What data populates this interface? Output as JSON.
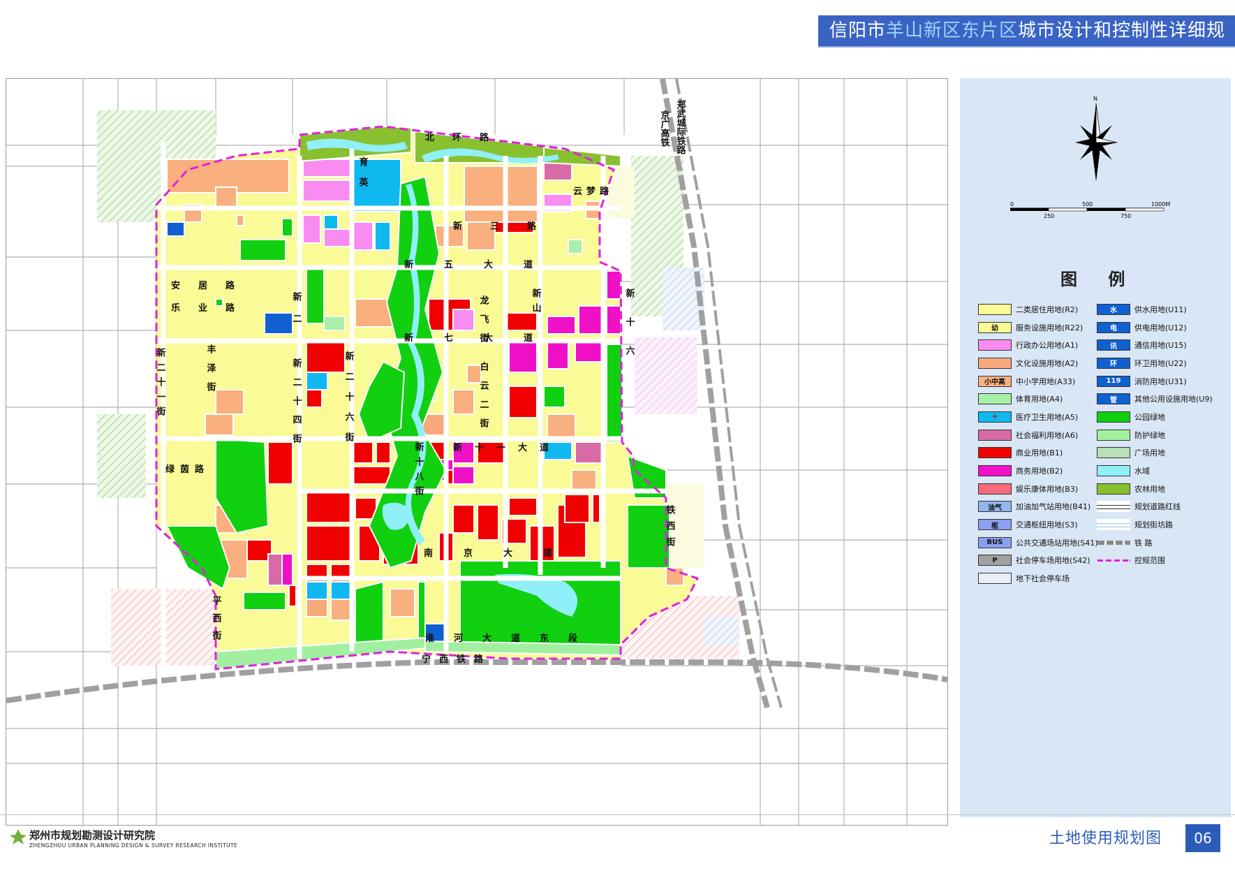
{
  "header": {
    "title_part1": "信阳市",
    "title_highlight": "羊山新区东片区",
    "title_part2": "城市设计和控制性详细规划"
  },
  "map": {
    "roads": {
      "north_ring": "北环路",
      "yuying": "育英",
      "xin_san": "新三路",
      "xin_wu": "新五大道",
      "xin_qi": "新七大道",
      "xin_shiyi": "新十一大道",
      "nanjing": "南京大道",
      "huaihe": "淮河大道东段",
      "ningxi_rail": "宁西铁路",
      "jingguang_rail": "京广高铁",
      "zhengwu_rail": "郑武城际铁路",
      "xin_er": "新二",
      "xin_ershiyi": "新二十一街",
      "xin_shiba": "新十八街",
      "xin_shiliu": "新十六",
      "xin_ershisi": "新二十四街",
      "xin_ershiliu": "新二十六街",
      "longfei": "龙飞街",
      "baiyun": "白云二街",
      "xinshan": "新山",
      "anju": "安居路",
      "leye": "乐业路",
      "fengze": "丰泽街",
      "tiexi": "铁西街",
      "pingxi": "平西街",
      "yunmeng": "云梦路",
      "lvyuan": "绿茵路"
    }
  },
  "legend": {
    "heading": "图 例",
    "left": [
      {
        "label": "二类居住用地(R2)",
        "color": "#fafa96",
        "mark": ""
      },
      {
        "label": "服务设施用地(R22)",
        "color": "#fafa96",
        "mark": "幼"
      },
      {
        "label": "行政办公用地(A1)",
        "color": "#f98cf0",
        "mark": ""
      },
      {
        "label": "文化设施用地(A2)",
        "color": "#f9a97b",
        "mark": ""
      },
      {
        "label": "中小学用地(A33)",
        "color": "#f9b07e",
        "mark": "小中高"
      },
      {
        "label": "体育用地(A4)",
        "color": "#a8f0a8",
        "mark": ""
      },
      {
        "label": "医疗卫生用地(A5)",
        "color": "#10b8f0",
        "mark": "+"
      },
      {
        "label": "社会福利用地(A6)",
        "color": "#d86aa8",
        "mark": ""
      },
      {
        "label": "商业用地(B1)",
        "color": "#f00000",
        "mark": ""
      },
      {
        "label": "商务用地(B2)",
        "color": "#f010c8",
        "mark": ""
      },
      {
        "label": "娱乐康体用地(B3)",
        "color": "#f56b7a",
        "mark": ""
      },
      {
        "label": "加油加气站用地(B41)",
        "color": "#90b8f0",
        "mark": "油气"
      },
      {
        "label": "交通枢纽用地(S3)",
        "color": "#8aa0f0",
        "mark": "枢"
      },
      {
        "label": "公共交通场站用地(S41)",
        "color": "#8aa0f0",
        "mark": "BUS"
      },
      {
        "label": "社会停车场用地(S42)",
        "color": "#a0a0a0",
        "mark": "P"
      },
      {
        "label": "地下社会停车场",
        "color": "#e8eef8",
        "mark": ""
      }
    ],
    "right": [
      {
        "label": "供水用地(U11)",
        "color": "#1060d0",
        "mark": "水"
      },
      {
        "label": "供电用地(U12)",
        "color": "#1060d0",
        "mark": "电"
      },
      {
        "label": "通信用地(U15)",
        "color": "#1060d0",
        "mark": "讯"
      },
      {
        "label": "环卫用地(U22)",
        "color": "#1060d0",
        "mark": "环"
      },
      {
        "label": "消防用地(U31)",
        "color": "#1060d0",
        "mark": "119"
      },
      {
        "label": "其他公用设施用地(U9)",
        "color": "#1060d0",
        "mark": "管"
      },
      {
        "label": "公园绿地",
        "color": "#10d010",
        "mark": ""
      },
      {
        "label": "防护绿地",
        "color": "#a0f0a0",
        "mark": ""
      },
      {
        "label": "广场用地",
        "color": "#b8e0b8",
        "mark": ""
      },
      {
        "label": "水域",
        "color": "#90f0f8",
        "mark": ""
      },
      {
        "label": "农林用地",
        "color": "#88c030",
        "mark": ""
      },
      {
        "label": "规划道路红线",
        "color": "#ffffff",
        "mark": ""
      },
      {
        "label": "规划街坊路",
        "color": "#ffffff",
        "mark": ""
      },
      {
        "label": "铁 路",
        "color": "#ffffff",
        "mark": ""
      },
      {
        "label": "控规范围",
        "color": "#ffffff",
        "mark": ""
      }
    ]
  },
  "compass": {
    "north": "N"
  },
  "scale": {
    "zero": "0",
    "t250": "250",
    "t500": "500",
    "t750": "750",
    "t1000": "1000M"
  },
  "footer": {
    "org_cn": "郑州市规划勘测设计研究院",
    "org_en": "ZHENGZHOU URBAN PLANNING DESIGN & SURVEY RESEARCH INSTITUTE",
    "sheet_title": "土地使用规划图",
    "sheet_no": "06"
  },
  "colors": {
    "residential": "#fafa96",
    "commercial": "#f00000",
    "business": "#f010c8",
    "school": "#f9b07e",
    "admin": "#f98cf0",
    "park": "#10d010",
    "water": "#90f0f8",
    "medical": "#10b8f0",
    "farm": "#88c030",
    "boundary": "#e020e0"
  }
}
